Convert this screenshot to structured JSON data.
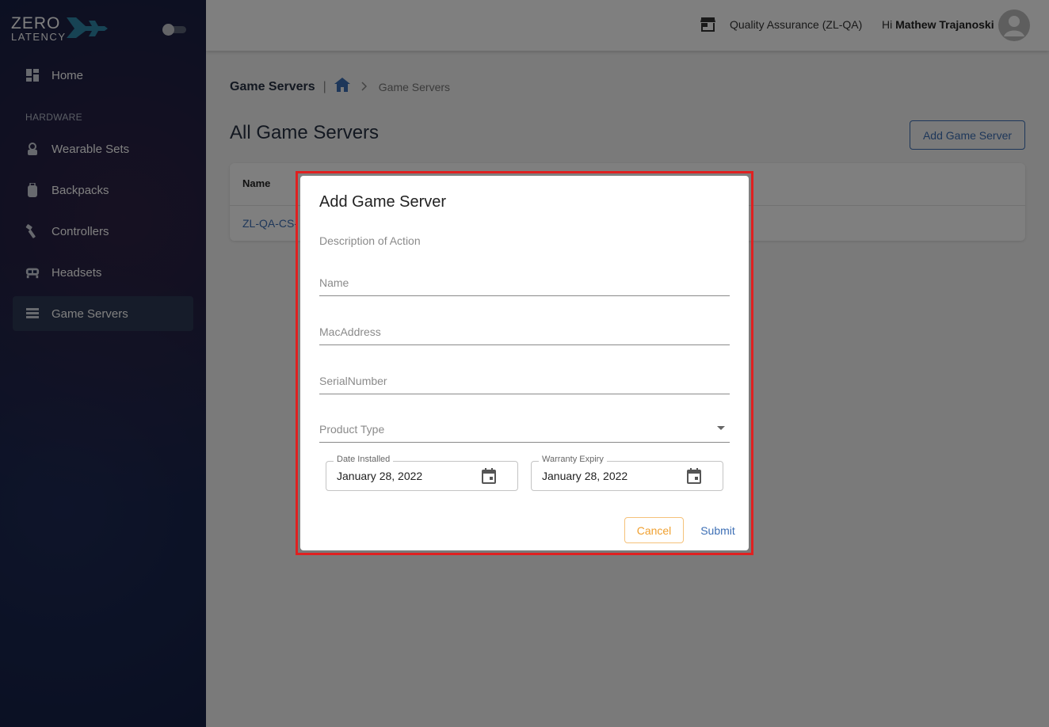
{
  "brand": {
    "line1": "ZERO",
    "line2": "LATENCY"
  },
  "sidebar": {
    "home_label": "Home",
    "section_label": "HARDWARE",
    "items": [
      {
        "label": "Wearable Sets",
        "icon": "wearable-icon"
      },
      {
        "label": "Backpacks",
        "icon": "backpack-icon"
      },
      {
        "label": "Controllers",
        "icon": "controller-icon"
      },
      {
        "label": "Headsets",
        "icon": "headset-icon"
      },
      {
        "label": "Game Servers",
        "icon": "server-icon",
        "active": true
      }
    ]
  },
  "header": {
    "org_name": "Quality Assurance (ZL-QA)",
    "greeting": "Hi",
    "user_name": "Mathew Trajanoski"
  },
  "breadcrumb": {
    "title": "Game Servers",
    "current": "Game Servers"
  },
  "page": {
    "title": "All Game Servers",
    "add_button": "Add Game Server"
  },
  "table": {
    "header_name": "Name",
    "rows": [
      {
        "name": "ZL-QA-CS-"
      }
    ]
  },
  "dialog": {
    "title": "Add Game Server",
    "description": "Description of Action",
    "name_placeholder": "Name",
    "mac_placeholder": "MacAddress",
    "serial_placeholder": "SerialNumber",
    "product_type_label": "Product Type",
    "date_installed_label": "Date Installed",
    "date_installed_value": "January 28, 2022",
    "warranty_label": "Warranty Expiry",
    "warranty_value": "January 28, 2022",
    "cancel": "Cancel",
    "submit": "Submit"
  },
  "colors": {
    "accent": "#3d6fb5",
    "sidebar_bg": "#152046",
    "cancel": "#f0a030",
    "highlight": "#e02020"
  }
}
